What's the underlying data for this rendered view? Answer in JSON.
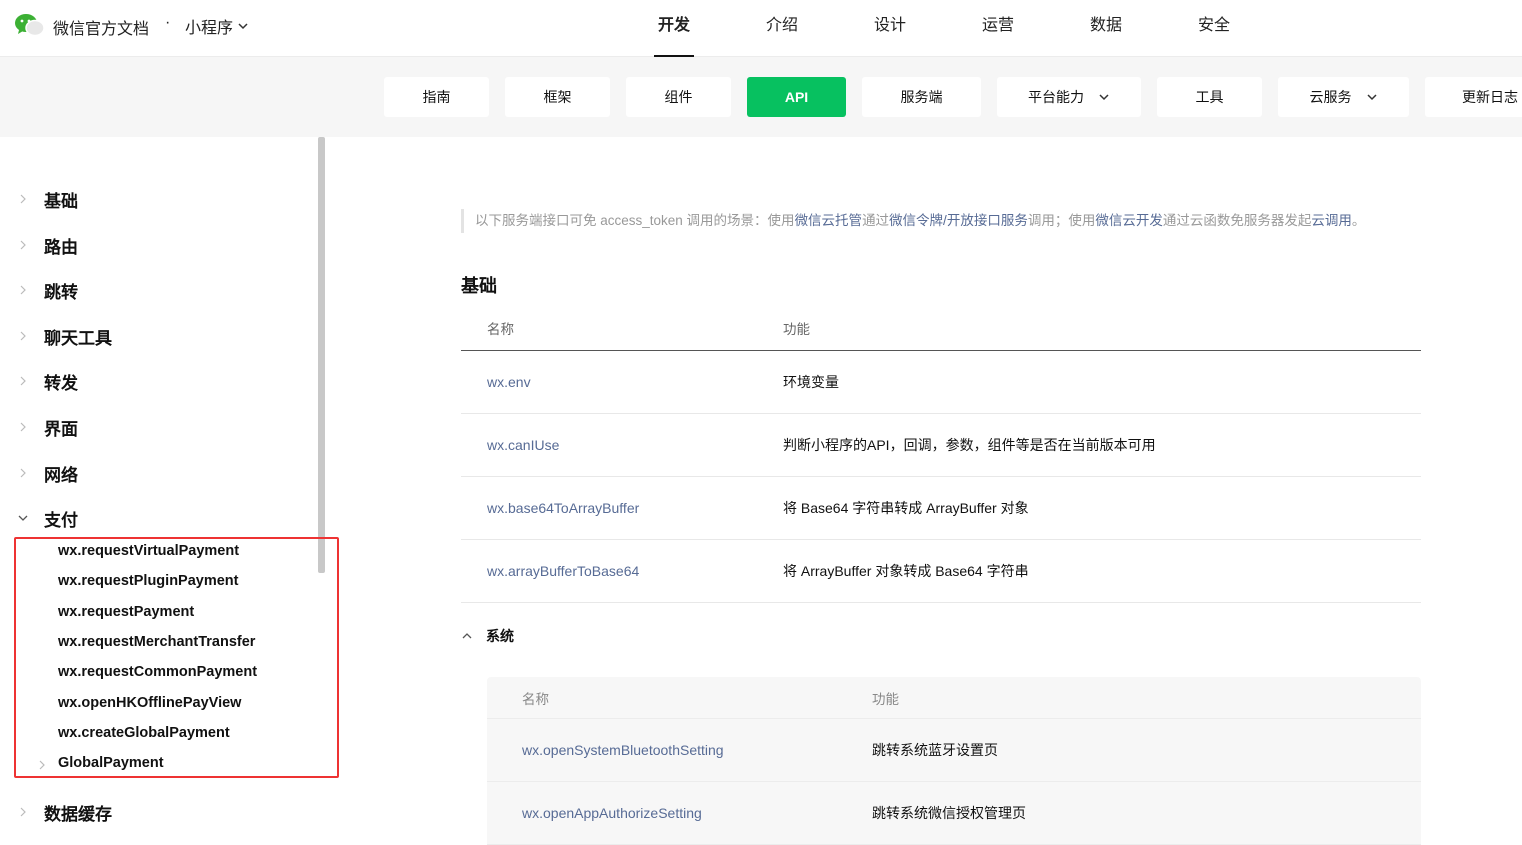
{
  "header": {
    "brand": "微信官方文档",
    "separator": "·",
    "product": "小程序",
    "nav": [
      "开发",
      "介绍",
      "设计",
      "运营",
      "数据",
      "安全"
    ]
  },
  "subnav": [
    {
      "label": "指南"
    },
    {
      "label": "框架"
    },
    {
      "label": "组件"
    },
    {
      "label": "API"
    },
    {
      "label": "服务端"
    },
    {
      "label": "平台能力"
    },
    {
      "label": "工具"
    },
    {
      "label": "云服务"
    },
    {
      "label": "更新日志"
    }
  ],
  "sidebar": {
    "items": [
      "基础",
      "路由",
      "跳转",
      "聊天工具",
      "转发",
      "界面",
      "网络",
      "支付"
    ],
    "payment_children": [
      "wx.requestVirtualPayment",
      "wx.requestPluginPayment",
      "wx.requestPayment",
      "wx.requestMerchantTransfer",
      "wx.requestCommonPayment",
      "wx.openHKOfflinePayView",
      "wx.createGlobalPayment",
      "GlobalPayment"
    ],
    "next_item": "数据缓存"
  },
  "notice": {
    "t1": "以下服务端接口可免 access_token 调用的场景：使用",
    "l1": "微信云托管",
    "t2": "通过",
    "l2": "微信令牌/开放接口服务",
    "t3": "调用；使用",
    "l3": "微信云开发",
    "t4": "通过云函数免服务器发起",
    "l4": "云调用",
    "t5": "。"
  },
  "basic": {
    "title": "基础",
    "col_name": "名称",
    "col_func": "功能",
    "rows": [
      {
        "name": "wx.env",
        "func": "环境变量"
      },
      {
        "name": "wx.canIUse",
        "func": "判断小程序的API，回调，参数，组件等是否在当前版本可用"
      },
      {
        "name": "wx.base64ToArrayBuffer",
        "func": "将 Base64 字符串转成 ArrayBuffer 对象"
      },
      {
        "name": "wx.arrayBufferToBase64",
        "func": "将 ArrayBuffer 对象转成 Base64 字符串"
      }
    ]
  },
  "system": {
    "title": "系统",
    "col_name": "名称",
    "col_func": "功能",
    "rows": [
      {
        "name": "wx.openSystemBluetoothSetting",
        "func": "跳转系统蓝牙设置页"
      },
      {
        "name": "wx.openAppAuthorizeSetting",
        "func": "跳转系统微信授权管理页"
      }
    ]
  },
  "colors": {
    "accent": "#07c160",
    "link": "#576b95",
    "highlight": "#e33333"
  }
}
